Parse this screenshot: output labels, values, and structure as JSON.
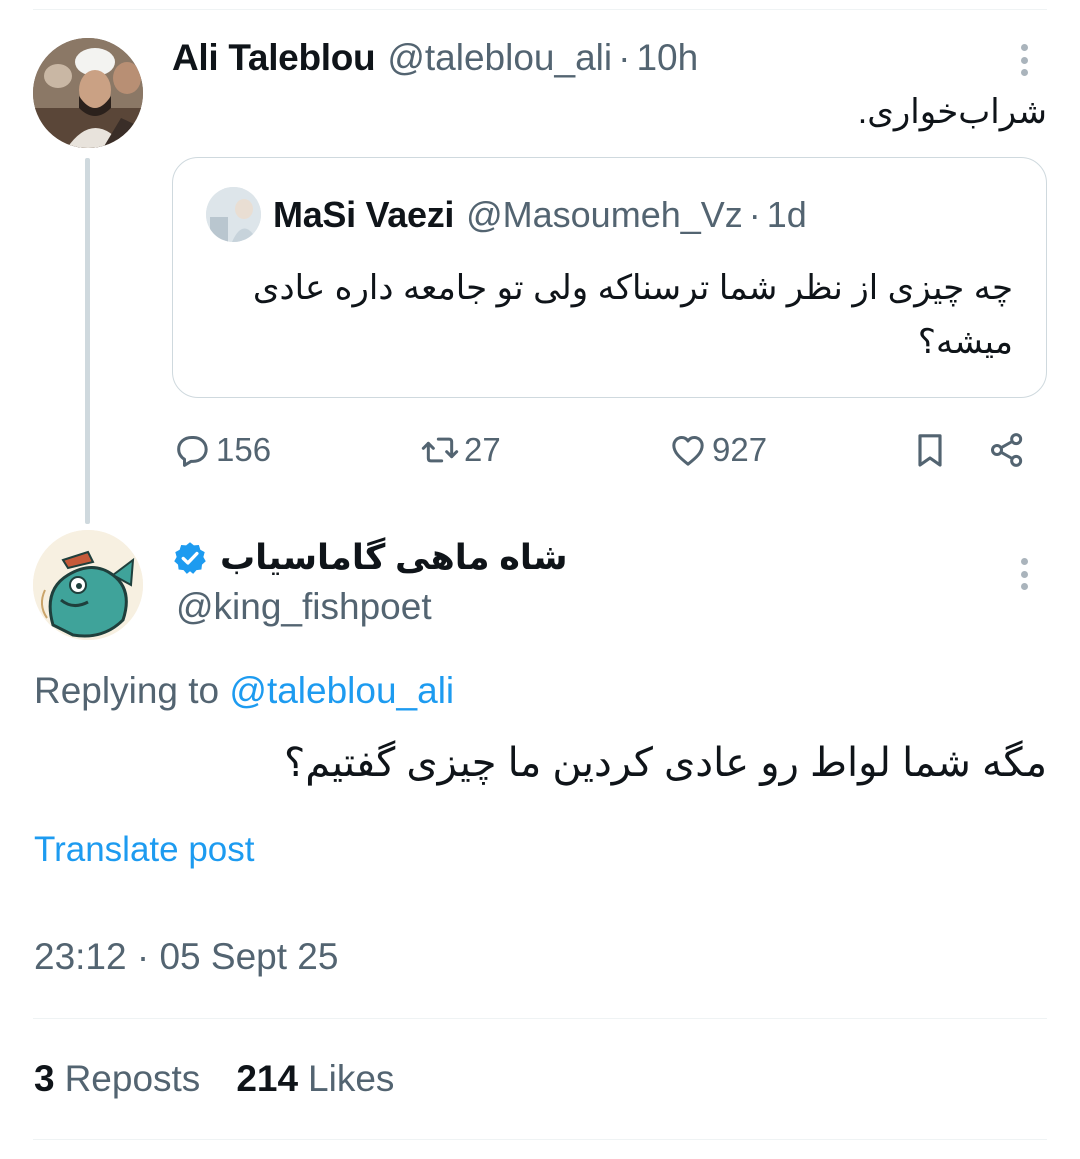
{
  "parent": {
    "name": "Ali Taleblou",
    "handle": "@taleblou_ali",
    "separator": "·",
    "time": "10h",
    "text": "شراب‌خواری.",
    "quote": {
      "name": "MaSi Vaezi",
      "handle": "@Masoumeh_Vz",
      "separator": "·",
      "time": "1d",
      "text": "چه چیزی از نظر شما ترسناکه ولی تو جامعه داره عادی میشه؟"
    },
    "actions": {
      "replies": "156",
      "reposts": "27",
      "likes": "927"
    }
  },
  "reply": {
    "name": "شاه ماهی گاماسیاب",
    "handle": "@king_fishpoet",
    "replying_prefix": "Replying to",
    "replying_handle": "@taleblou_ali",
    "text": "مگه شما لواط رو عادی کردین ما چیزی گفتیم؟",
    "translate": "Translate post",
    "timestamp": "23:12 · 05 Sept 25",
    "stats": {
      "reposts_count": "3",
      "reposts_label": "Reposts",
      "likes_count": "214",
      "likes_label": "Likes"
    }
  },
  "icons": {
    "reply": "speech-bubble-icon",
    "repost": "repost-arrows-icon",
    "like": "heart-icon",
    "bookmark": "bookmark-icon",
    "share": "share-icon",
    "more": "vertical-dots-icon",
    "verified": "verified-badge-icon"
  },
  "colors": {
    "text": "#0f1419",
    "secondary": "#536471",
    "accent": "#1d9bf0",
    "border": "#cfd9de"
  }
}
